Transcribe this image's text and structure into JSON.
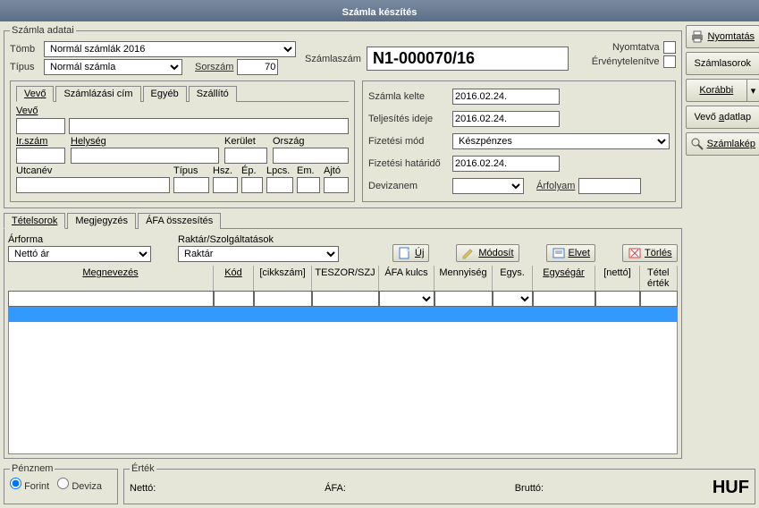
{
  "title": "Számla készítés",
  "invoice": {
    "legend": "Számla adatai",
    "tomb_label": "Tömb",
    "tomb_value": "Normál számlák 2016",
    "tipus_label": "Típus",
    "tipus_value": "Normál számla",
    "sorszam_label": "Sorszám",
    "sorszam_value": "70",
    "szamlaszam_label": "Számlaszám",
    "szamlaszam_value": "N1-000070/16",
    "nyomtatva_label": "Nyomtatva",
    "ervenytelenitve_label": "Érvénytelenítve"
  },
  "side": {
    "nyomtatas": "Nyomtatás",
    "szamlasorok": "Számlasorok",
    "korabbi": "Korábbi",
    "vevo_adatlap": "Vevő adatlap",
    "szamlakep": "Számlakép"
  },
  "buyer_tabs": [
    "Vevő",
    "Számlázási cím",
    "Egyéb",
    "Szállító"
  ],
  "buyer_fields": {
    "vevo": "Vevő",
    "irszam": "Ir.szám",
    "helyseg": "Helység",
    "kerulet": "Kerület",
    "orszag": "Ország",
    "utcanev": "Utcanév",
    "tipus": "Típus",
    "hsz": "Hsz.",
    "ep": "Ép.",
    "lpcs": "Lpcs.",
    "em": "Em.",
    "ajto": "Ajtó"
  },
  "dates": {
    "kelte_label": "Számla kelte",
    "kelte_value": "2016.02.24.",
    "teljesites_label": "Teljesítés ideje",
    "teljesites_value": "2016.02.24.",
    "fizmod_label": "Fizetési mód",
    "fizmod_value": "Készpénzes",
    "hatarido_label": "Fizetési határidő",
    "hatarido_value": "2016.02.24.",
    "devizanem_label": "Devizanem",
    "arfolyam_label": "Árfolyam"
  },
  "detail_tabs": [
    "Tételsorok",
    "Megjegyzés",
    "ÁFA összesítés"
  ],
  "items_panel": {
    "arforma_label": "Árforma",
    "arforma_value": "Nettó ár",
    "raktar_label": "Raktár/Szolgáltatások",
    "raktar_value": "Raktár",
    "uj": "Új",
    "modosit": "Módosít",
    "elvet": "Elvet",
    "torles": "Törlés",
    "cols": {
      "megnevezes": "Megnevezés",
      "kod": "Kód",
      "cikkszam": "[cikkszám]",
      "teszor": "TESZOR/SZJ",
      "afakulcs": "ÁFA kulcs",
      "mennyiseg": "Mennyiség",
      "egys": "Egys.",
      "egysegar": "Egységár",
      "netto": "[nettó]",
      "tetelertek": "Tétel érték"
    }
  },
  "footer": {
    "penznem_legend": "Pénznem",
    "forint": "Forint",
    "deviza": "Deviza",
    "ertek_legend": "Érték",
    "netto": "Nettó:",
    "afa": "ÁFA:",
    "brutto": "Bruttó:",
    "currency": "HUF"
  }
}
